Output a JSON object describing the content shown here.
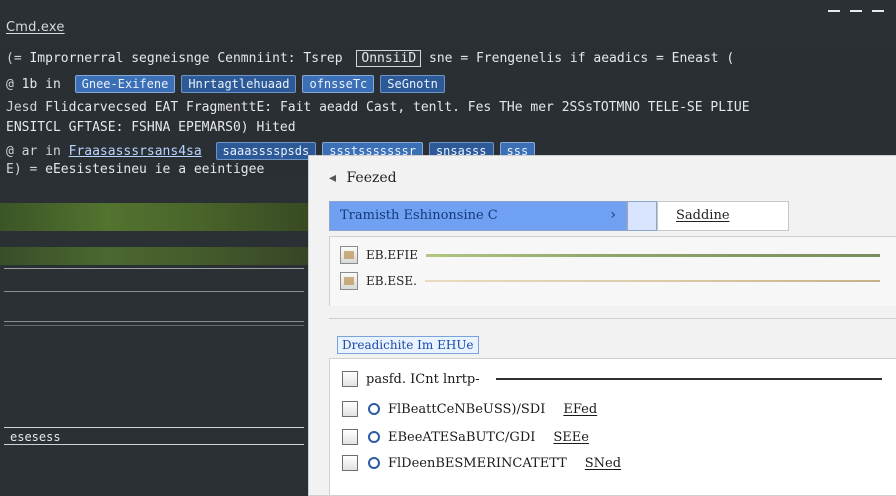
{
  "window": {
    "title": "Cmd.exe"
  },
  "console": {
    "lines": [
      {
        "prefix": "(=",
        "text": "Imprornerral segneisnge Cenmniint: Tsrep",
        "boxed": "OnnsiiD",
        "tail": "sne = Frengenelis if aeadics = Eneast ("
      },
      {
        "prefix": "@",
        "text": "1b in",
        "pills": [
          "Gnee-Exifene",
          "Hnrtagtlehuaad",
          "ofnsseTc",
          "SeGnotn"
        ]
      },
      {
        "prefix": "Jesd",
        "text": "Flidcarvecsed EAT FragmenttE: Fait aeadd Cast, tenlt. Fes THe mer 2SSsTOTMNO TELE-SE PLIUE"
      },
      {
        "prefix": "",
        "text": "ENSITCL GFTASE: FSHNA EPEMARS0) Hited"
      },
      {
        "prefix": "@ ar in",
        "text": "Fraasasssrsans4sa",
        "pills": [
          "saaasssspsds",
          "ssstsssssssr",
          "snsasss",
          "sss"
        ]
      },
      {
        "prefix": "E) =",
        "text": "eEesistesineu ie a eeintigee"
      }
    ]
  },
  "left_panel": {
    "footer": "esesess"
  },
  "modal": {
    "title": "Feezed",
    "path": {
      "text": "Tramisth Eshinonsine C",
      "chevron": "right-chevron-icon",
      "right_text": "Saddine"
    },
    "upper_items": [
      {
        "label": "EB.EFIE"
      },
      {
        "label": "EB.ESE."
      }
    ],
    "section_title": "Dreadichite Im EHUe",
    "lower_items": [
      {
        "text": "pasfd. ICnt lnrtp-",
        "right": ""
      },
      {
        "text": "FlBeattCeNBeUSS)/SDI",
        "right": "EFed"
      },
      {
        "text": "EBeeATESaBUTC/GDI",
        "right": "SEEe"
      },
      {
        "text": "FlDeenBESMERINCATETT",
        "right": "SNed"
      }
    ]
  },
  "icons": {
    "window_controls": [
      "minimize-icon",
      "maximize-icon",
      "close-icon"
    ],
    "title_icon": "info-icon"
  }
}
